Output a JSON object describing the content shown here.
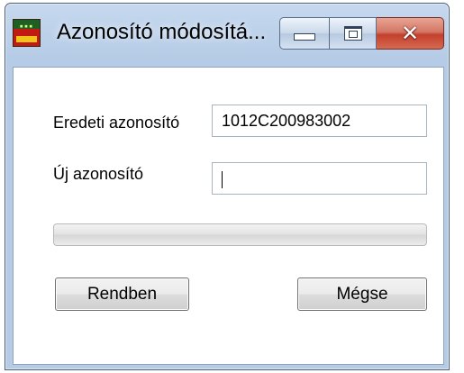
{
  "window": {
    "title": "Azonosító módosítá...",
    "app_icon": "green-red-application-icon",
    "controls": {
      "minimize_icon": "minimize-icon",
      "maximize_icon": "maximize-icon",
      "close_icon": "close-icon",
      "close_glyph": "✕"
    }
  },
  "form": {
    "original_id_label": "Eredeti azonosító",
    "original_id_value": "1012C200983002",
    "new_id_label": "Új azonosító",
    "new_id_value": ""
  },
  "progress": {
    "value_fraction": 0
  },
  "buttons": {
    "ok_label": "Rendben",
    "cancel_label": "Mégse"
  },
  "colors": {
    "frame": "#b6cce6",
    "close_button": "#c4402c",
    "progress_fill": "#5fd35f"
  }
}
